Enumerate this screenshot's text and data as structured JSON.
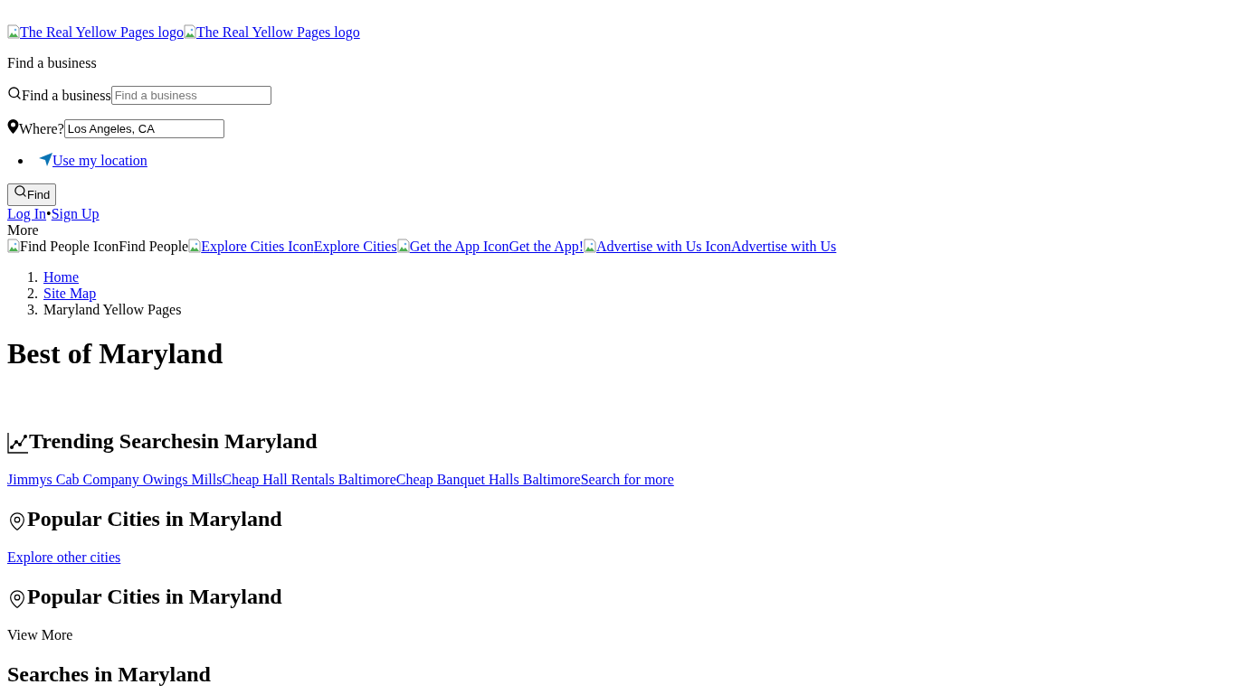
{
  "logos": [
    "The Real Yellow Pages logo",
    "The Real Yellow Pages logo"
  ],
  "search_heading": "Find a business",
  "what_field": {
    "label": "Find a business",
    "placeholder": "Find a business"
  },
  "where_field": {
    "label": "Where?",
    "value": "Los Angeles, CA"
  },
  "location_link": "Use my location",
  "find_button": "Find",
  "auth_links": [
    "Log In",
    "Sign Up"
  ],
  "auth_separator": "•",
  "more_label": "More",
  "nav": [
    {
      "alt": "Find People Icon",
      "label": "Find People",
      "kind": "text"
    },
    {
      "alt": "Explore Cities Icon",
      "label": "Explore Cities",
      "kind": "link"
    },
    {
      "alt": "Get the App Icon",
      "label": "Get the App!",
      "kind": "link"
    },
    {
      "alt": "Advertise with Us Icon",
      "label": "Advertise with Us",
      "kind": "link"
    }
  ],
  "breadcrumb": [
    {
      "number": "1.",
      "label": "Home",
      "kind": "link"
    },
    {
      "number": "2.",
      "label": "Site Map",
      "kind": "link"
    },
    {
      "number": "3.",
      "label": "Maryland Yellow Pages",
      "kind": "text"
    }
  ],
  "title": "Best of Maryland",
  "sections": [
    {
      "kind": "trending",
      "heading": "Trending Searches",
      "heading_suffix": "in Maryland",
      "links": [
        "Jimmys Cab Company Owings Mills",
        "Cheap Hall Rentals Baltimore",
        "Cheap Banquet Halls Baltimore",
        "Search for more"
      ]
    },
    {
      "kind": "cities",
      "heading": "Popular Cities in Maryland",
      "links": [
        "Explore other cities"
      ]
    },
    {
      "kind": "cities",
      "heading": "Popular Cities in Maryland",
      "text": "View More"
    },
    {
      "kind": "searches",
      "heading": "Searches in Maryland"
    }
  ]
}
